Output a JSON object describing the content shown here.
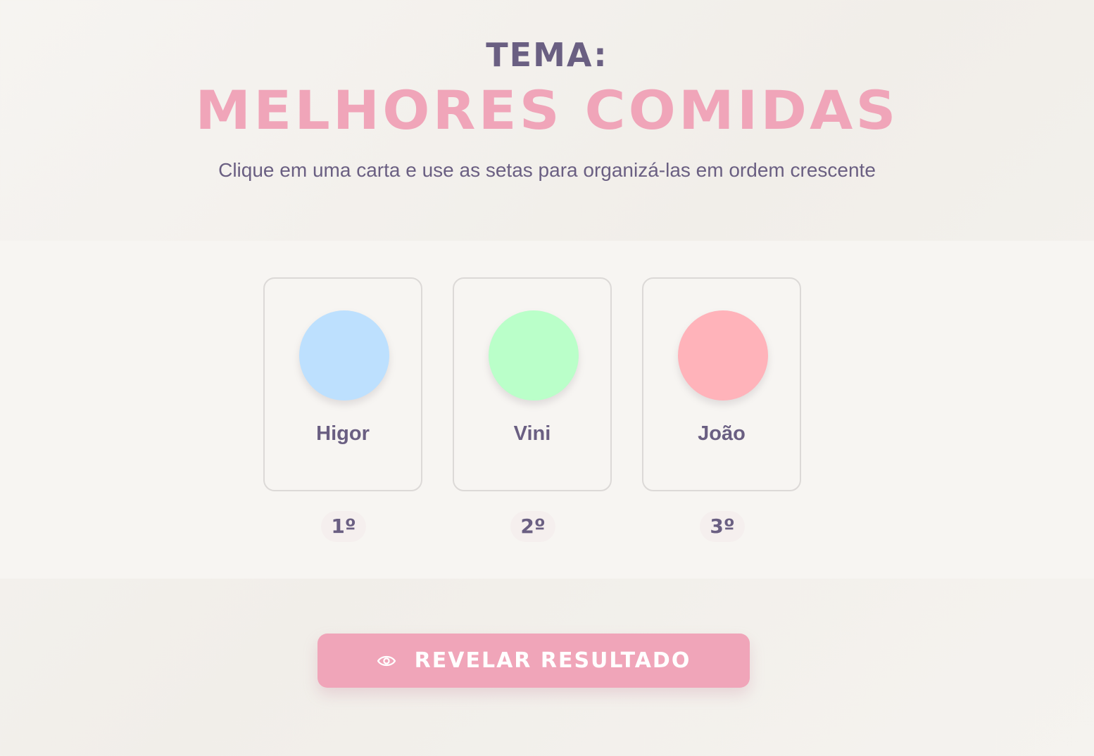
{
  "header": {
    "theme_label": "TEMA:",
    "theme_title": "MELHORES COMIDAS",
    "instructions": "Clique em uma carta e use as setas para organizá-las em ordem crescente"
  },
  "cards": [
    {
      "name": "Higor",
      "color": "#bde0fe",
      "rank": "1º"
    },
    {
      "name": "Vini",
      "color": "#baffc9",
      "rank": "2º"
    },
    {
      "name": "João",
      "color": "#ffb3ba",
      "rank": "3º"
    }
  ],
  "actions": {
    "reveal_label": "REVELAR RESULTADO",
    "reveal_icon": "eye-icon"
  },
  "colors": {
    "accent_pink": "#f0a5b9",
    "text_purple": "#6a5f82",
    "background": "#f6f4f1"
  }
}
